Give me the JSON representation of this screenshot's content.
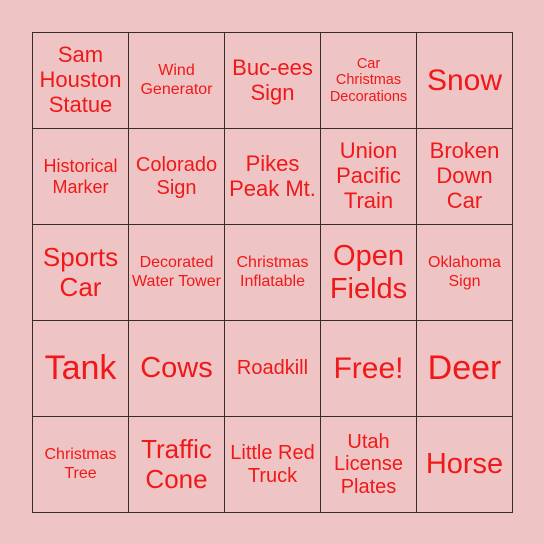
{
  "board": {
    "cells": [
      [
        "Sam Houston Statue",
        "Wind Generator",
        "Buc-ees Sign",
        "Car Christmas Decorations",
        "Snow"
      ],
      [
        "Historical Marker",
        "Colorado Sign",
        "Pikes Peak Mt.",
        "Union Pacific Train",
        "Broken Down Car"
      ],
      [
        "Sports Car",
        "Decorated Water Tower",
        "Christmas Inflatable",
        "Open Fields",
        "Oklahoma Sign"
      ],
      [
        "Tank",
        "Cows",
        "Roadkill",
        "Free!",
        "Deer"
      ],
      [
        "Christmas Tree",
        "Traffic Cone",
        "Little Red Truck",
        "Utah License Plates",
        "Horse"
      ]
    ]
  },
  "colors": {
    "background": "#efc4c4",
    "text": "#f01818",
    "grid": "#3a2a2a"
  }
}
